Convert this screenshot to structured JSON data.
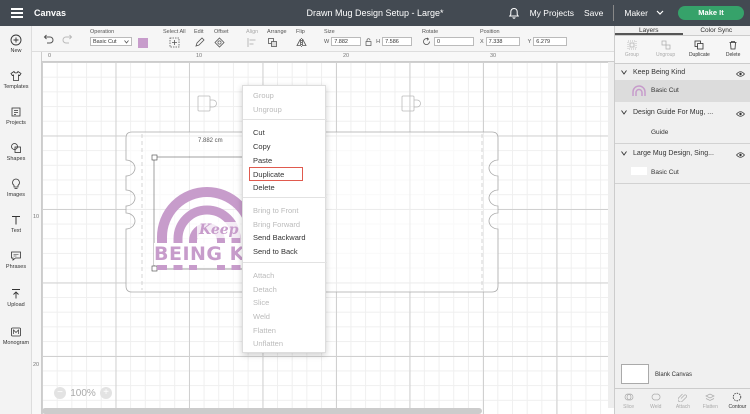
{
  "topbar": {
    "app_name": "Canvas",
    "doc_title": "Drawn Mug Design Setup - Large*",
    "my_projects": "My Projects",
    "save": "Save",
    "machine": "Maker",
    "make_it": "Make It"
  },
  "sidebar": {
    "items": [
      {
        "label": "New",
        "icon": "plus-icon"
      },
      {
        "label": "Templates",
        "icon": "shirt-icon"
      },
      {
        "label": "Projects",
        "icon": "folder-icon"
      },
      {
        "label": "Shapes",
        "icon": "shapes-icon"
      },
      {
        "label": "Images",
        "icon": "lightbulb-icon"
      },
      {
        "label": "Text",
        "icon": "text-icon"
      },
      {
        "label": "Phrases",
        "icon": "speech-bubble-icon"
      },
      {
        "label": "Upload",
        "icon": "upload-icon"
      },
      {
        "label": "Monogram",
        "icon": "monogram-icon"
      }
    ]
  },
  "toolbar": {
    "operation_label": "Operation",
    "operation_value": "Basic Cut",
    "operation_color": "#c79ccb",
    "select_all": "Select All",
    "edit": "Edit",
    "offset": "Offset",
    "align": "Align",
    "arrange": "Arrange",
    "flip": "Flip",
    "size_label": "Size",
    "width_label": "W",
    "width_value": "7.882",
    "height_label": "H",
    "height_value": "7.586",
    "rotate_label": "Rotate",
    "rotate_value": "0",
    "position_label": "Position",
    "x_label": "X",
    "x_value": "7.338",
    "y_label": "Y",
    "y_value": "6.279"
  },
  "canvas": {
    "ruler_top": [
      "0",
      "10",
      "20",
      "30"
    ],
    "ruler_left": [
      "10",
      "20"
    ],
    "dimension_label": "7.882 cm",
    "design_text_1": "Keep",
    "design_text_2": "BEING KI",
    "zoom": "100%",
    "zoom_minus": "−",
    "zoom_plus": "+"
  },
  "context_menu": {
    "group": "Group",
    "ungroup": "Ungroup",
    "cut": "Cut",
    "copy": "Copy",
    "paste": "Paste",
    "duplicate": "Duplicate",
    "delete": "Delete",
    "bring_to_front": "Bring to Front",
    "bring_forward": "Bring Forward",
    "send_backward": "Send Backward",
    "send_to_back": "Send to Back",
    "attach": "Attach",
    "detach": "Detach",
    "slice": "Slice",
    "weld": "Weld",
    "flatten": "Flatten",
    "unflatten": "Unflatten"
  },
  "right_panel": {
    "tab_layers": "Layers",
    "tab_color_sync": "Color Sync",
    "action_group": "Group",
    "action_ungroup": "Ungroup",
    "action_duplicate": "Duplicate",
    "action_delete": "Delete",
    "layer_groups": [
      {
        "title": "Keep Being Kind",
        "child": "Basic Cut"
      },
      {
        "title": "Design Guide For Mug, ...",
        "child": "Guide"
      },
      {
        "title": "Large Mug Design, Sing...",
        "child": "Basic Cut"
      }
    ],
    "blank_canvas": "Blank Canvas",
    "bottom_actions": [
      "Slice",
      "Weld",
      "Attach",
      "Flatten",
      "Contour"
    ]
  },
  "colors": {
    "topbar_bg": "#434a52",
    "make_it_green": "#36a26a",
    "design_purple": "#c79ccb",
    "highlight_red": "#e05a4e"
  }
}
